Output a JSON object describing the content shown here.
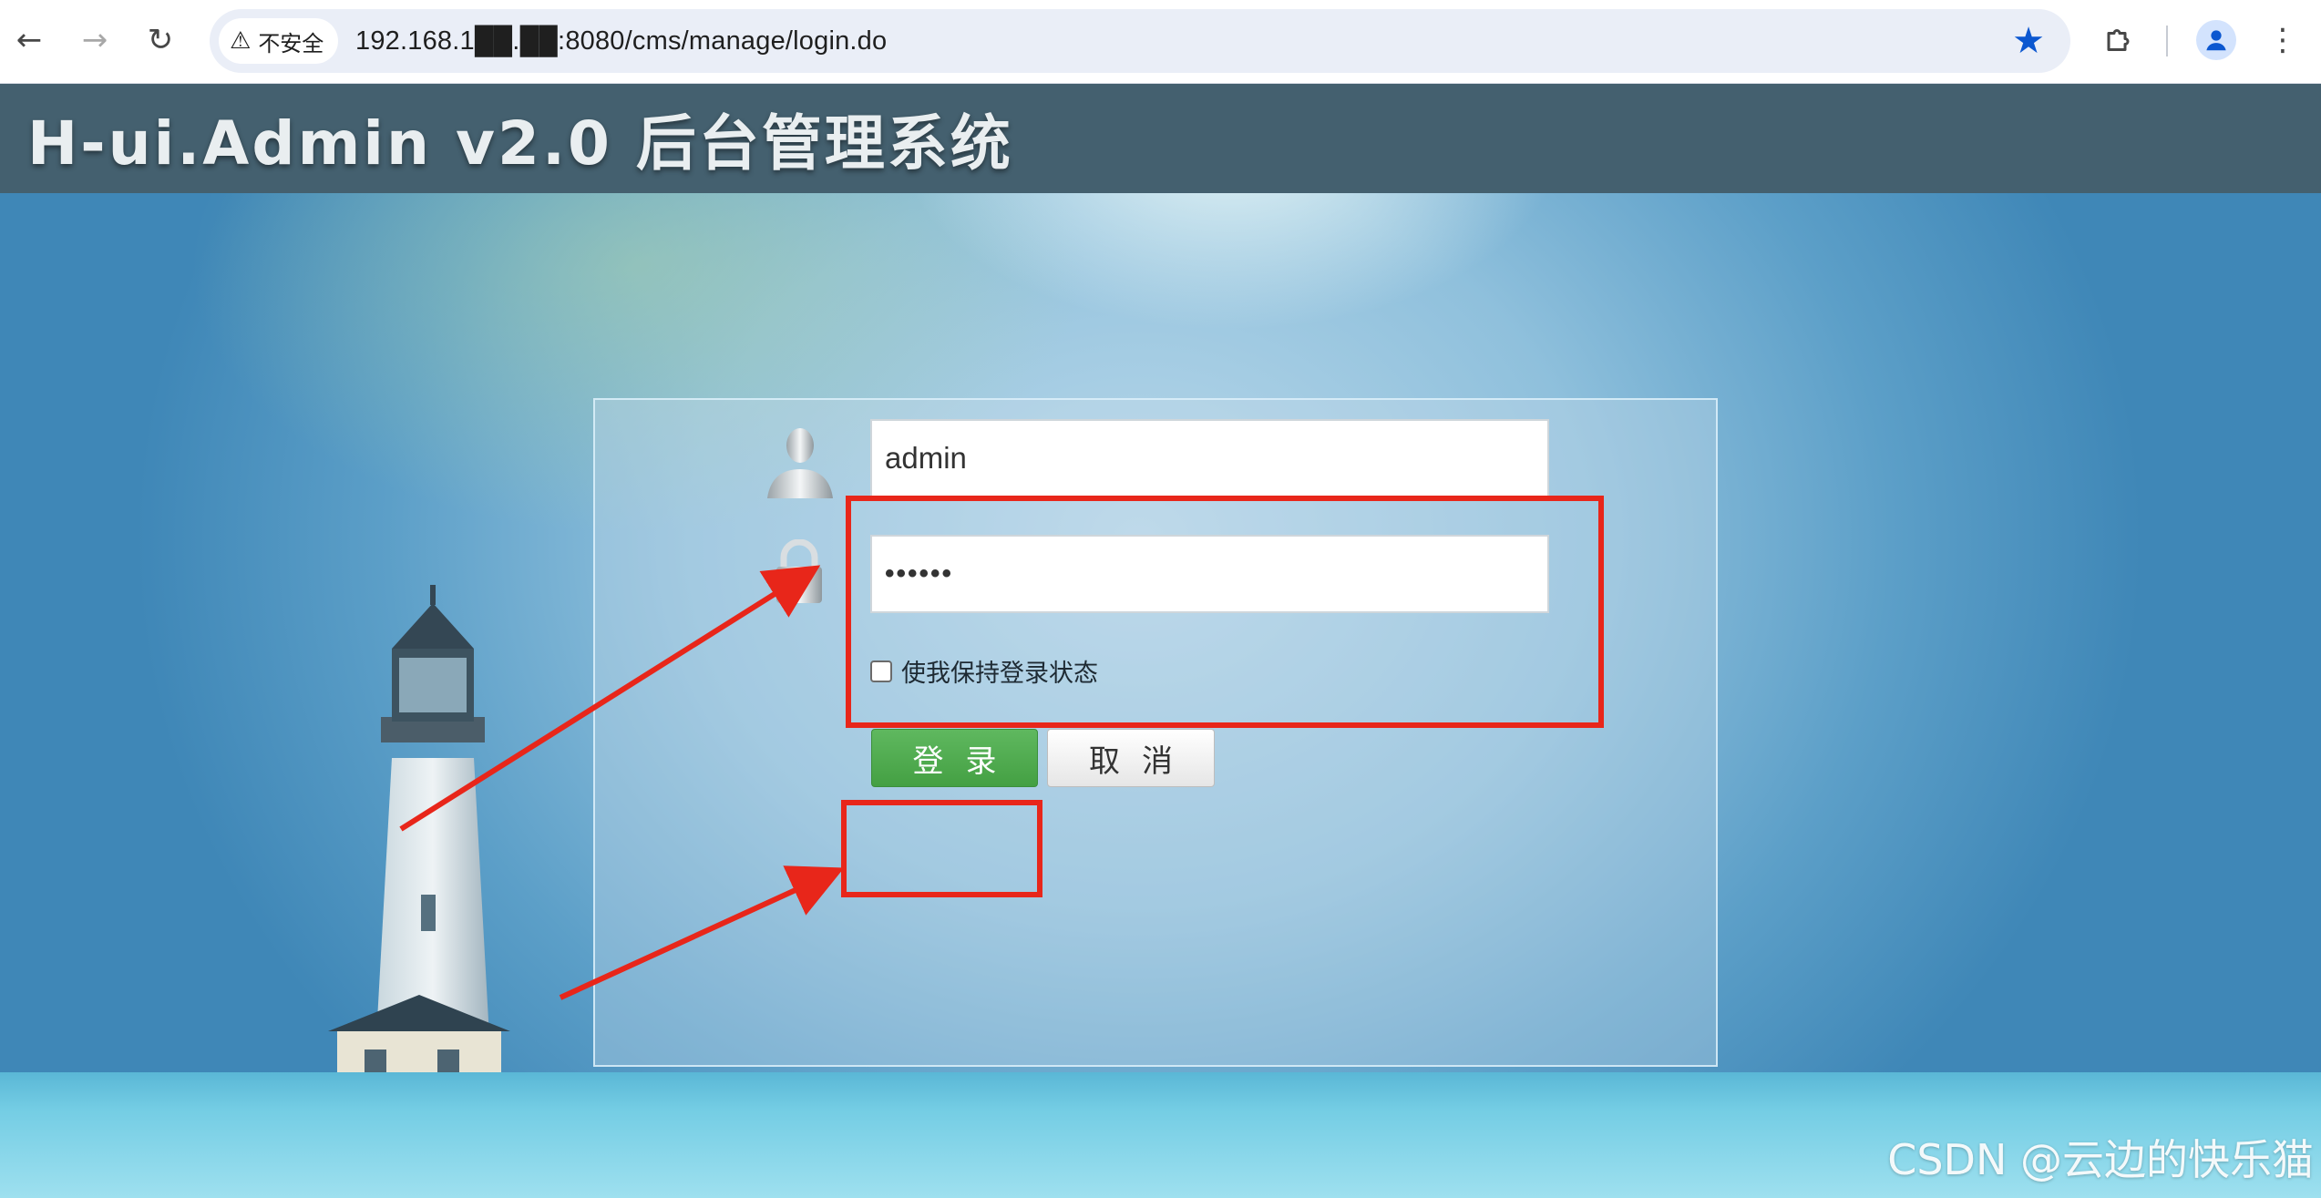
{
  "browser": {
    "security_label": "不安全",
    "url": "192.168.1██.██:8080/cms/manage/login.do"
  },
  "header": {
    "title": "H-ui.Admin v2.0 后台管理系统"
  },
  "login": {
    "username_value": "admin",
    "password_value": "••••••",
    "remember_label": "使我保持登录状态",
    "remember_checked": false,
    "login_button": "登录",
    "cancel_button": "取消"
  },
  "watermark": "CSDN @云边的快乐猫",
  "colors": {
    "header_bg": "#44606f",
    "login_button": "#4cae4c",
    "highlight": "#e8261a",
    "star": "#0b57d0"
  },
  "icons": [
    "back-icon",
    "forward-icon",
    "reload-icon",
    "warning-icon",
    "bookmark-star-icon",
    "extensions-icon",
    "profile-icon",
    "more-menu-icon",
    "user-icon",
    "lock-icon"
  ]
}
